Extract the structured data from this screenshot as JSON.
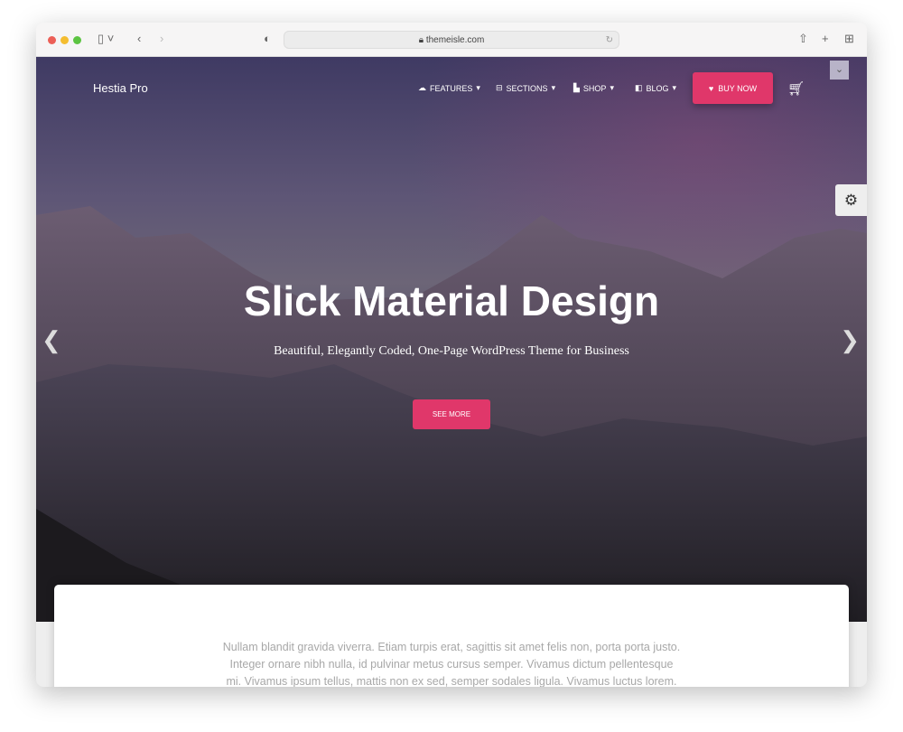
{
  "browser": {
    "url": "themeisle.com"
  },
  "header": {
    "brand": "Hestia Pro",
    "nav": [
      {
        "label": "FEATURES",
        "icon": "cloud-icon"
      },
      {
        "label": "SECTIONS",
        "icon": "sections-icon"
      },
      {
        "label": "SHOP",
        "icon": "bag-icon"
      },
      {
        "label": "BLOG",
        "icon": "blog-icon"
      }
    ],
    "buy_label": "BUY NOW"
  },
  "hero": {
    "title": "Slick Material Design",
    "subtitle": "Beautiful, Elegantly Coded, One-Page WordPress Theme for Business",
    "button": "SEE MORE"
  },
  "content": {
    "paragraph": "Nullam blandit gravida viverra. Etiam turpis erat, sagittis sit amet felis non, porta porta justo. Integer ornare nibh nulla, id pulvinar metus cursus semper. Vivamus dictum pellentesque mi. Vivamus ipsum tellus, mattis non ex sed, semper sodales ligula. Vivamus luctus lorem."
  },
  "colors": {
    "accent": "#e0376a"
  }
}
